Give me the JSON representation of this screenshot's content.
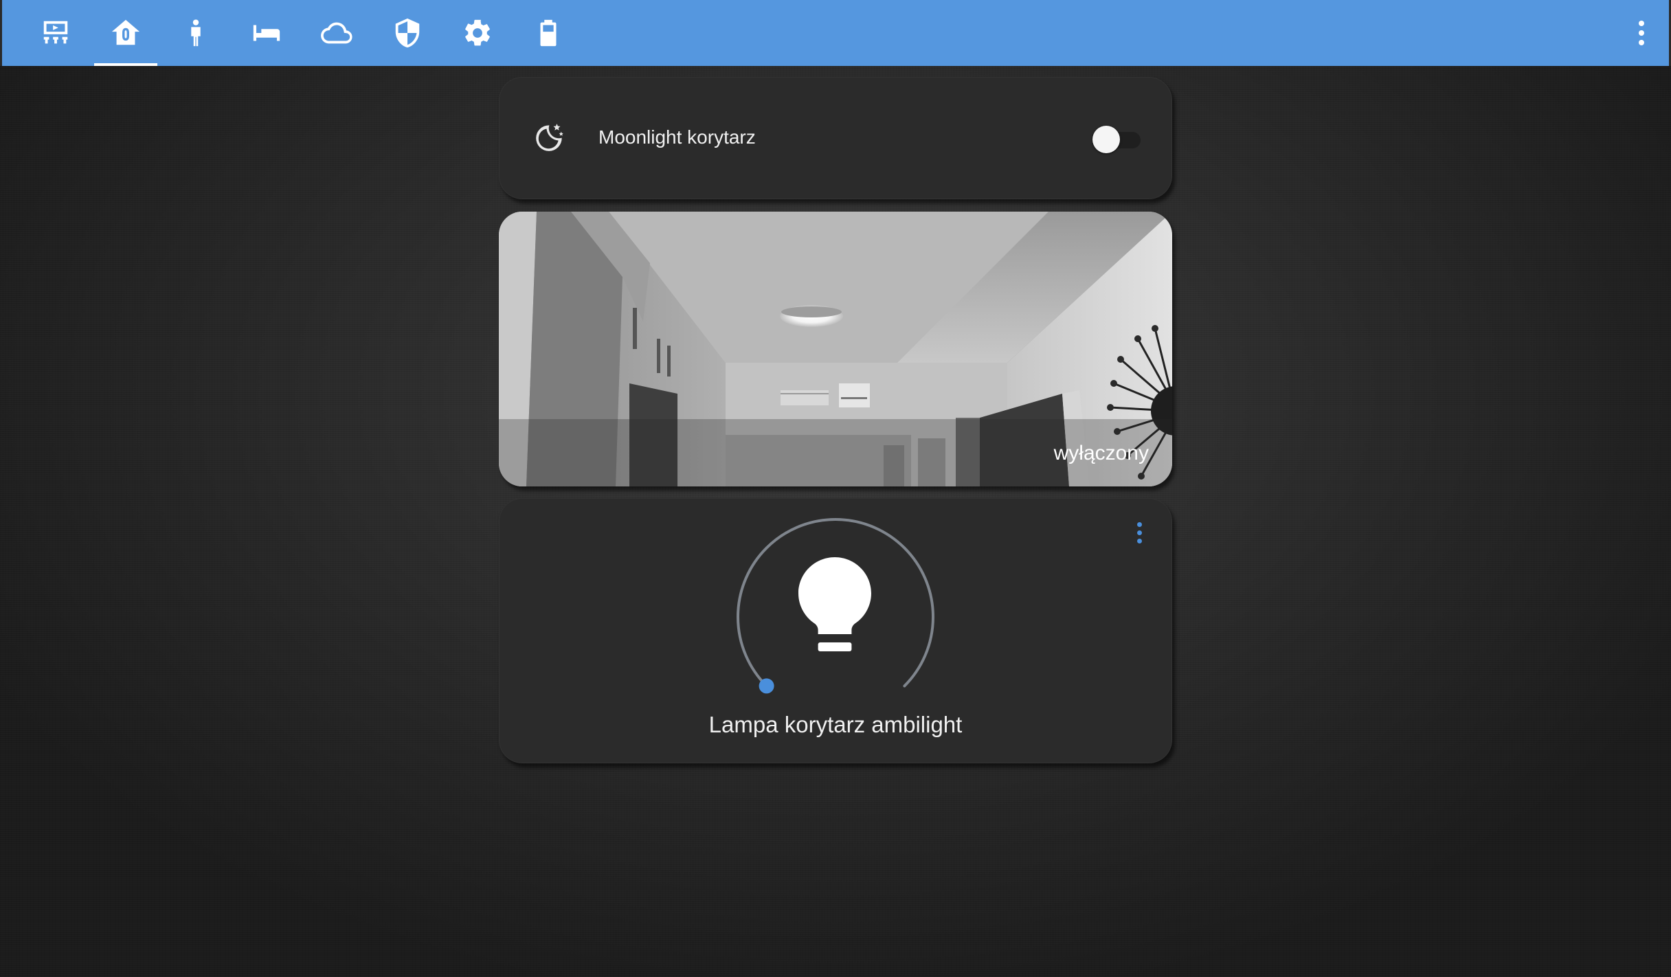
{
  "topbar": {
    "background_color": "#5597df",
    "tabs": [
      {
        "icon": "cinema-icon",
        "active": false
      },
      {
        "icon": "home-icon",
        "active": true
      },
      {
        "icon": "person-icon",
        "active": false
      },
      {
        "icon": "bed-icon",
        "active": false
      },
      {
        "icon": "cloud-icon",
        "active": false
      },
      {
        "icon": "shield-icon",
        "active": false
      },
      {
        "icon": "gear-icon",
        "active": false
      },
      {
        "icon": "battery-icon",
        "active": false
      }
    ],
    "menu_icon": "dots-vertical-icon"
  },
  "moonlight_card": {
    "icon": "moon-stars-icon",
    "label": "Moonlight korytarz",
    "toggle_on": false
  },
  "camera_card": {
    "status": "wyłączony"
  },
  "light_card": {
    "icon": "lightbulb-icon",
    "menu_icon": "dots-vertical-icon",
    "name": "Lampa korytarz ambilight",
    "brightness_level": 0,
    "accent_color": "#4a8fdc"
  }
}
